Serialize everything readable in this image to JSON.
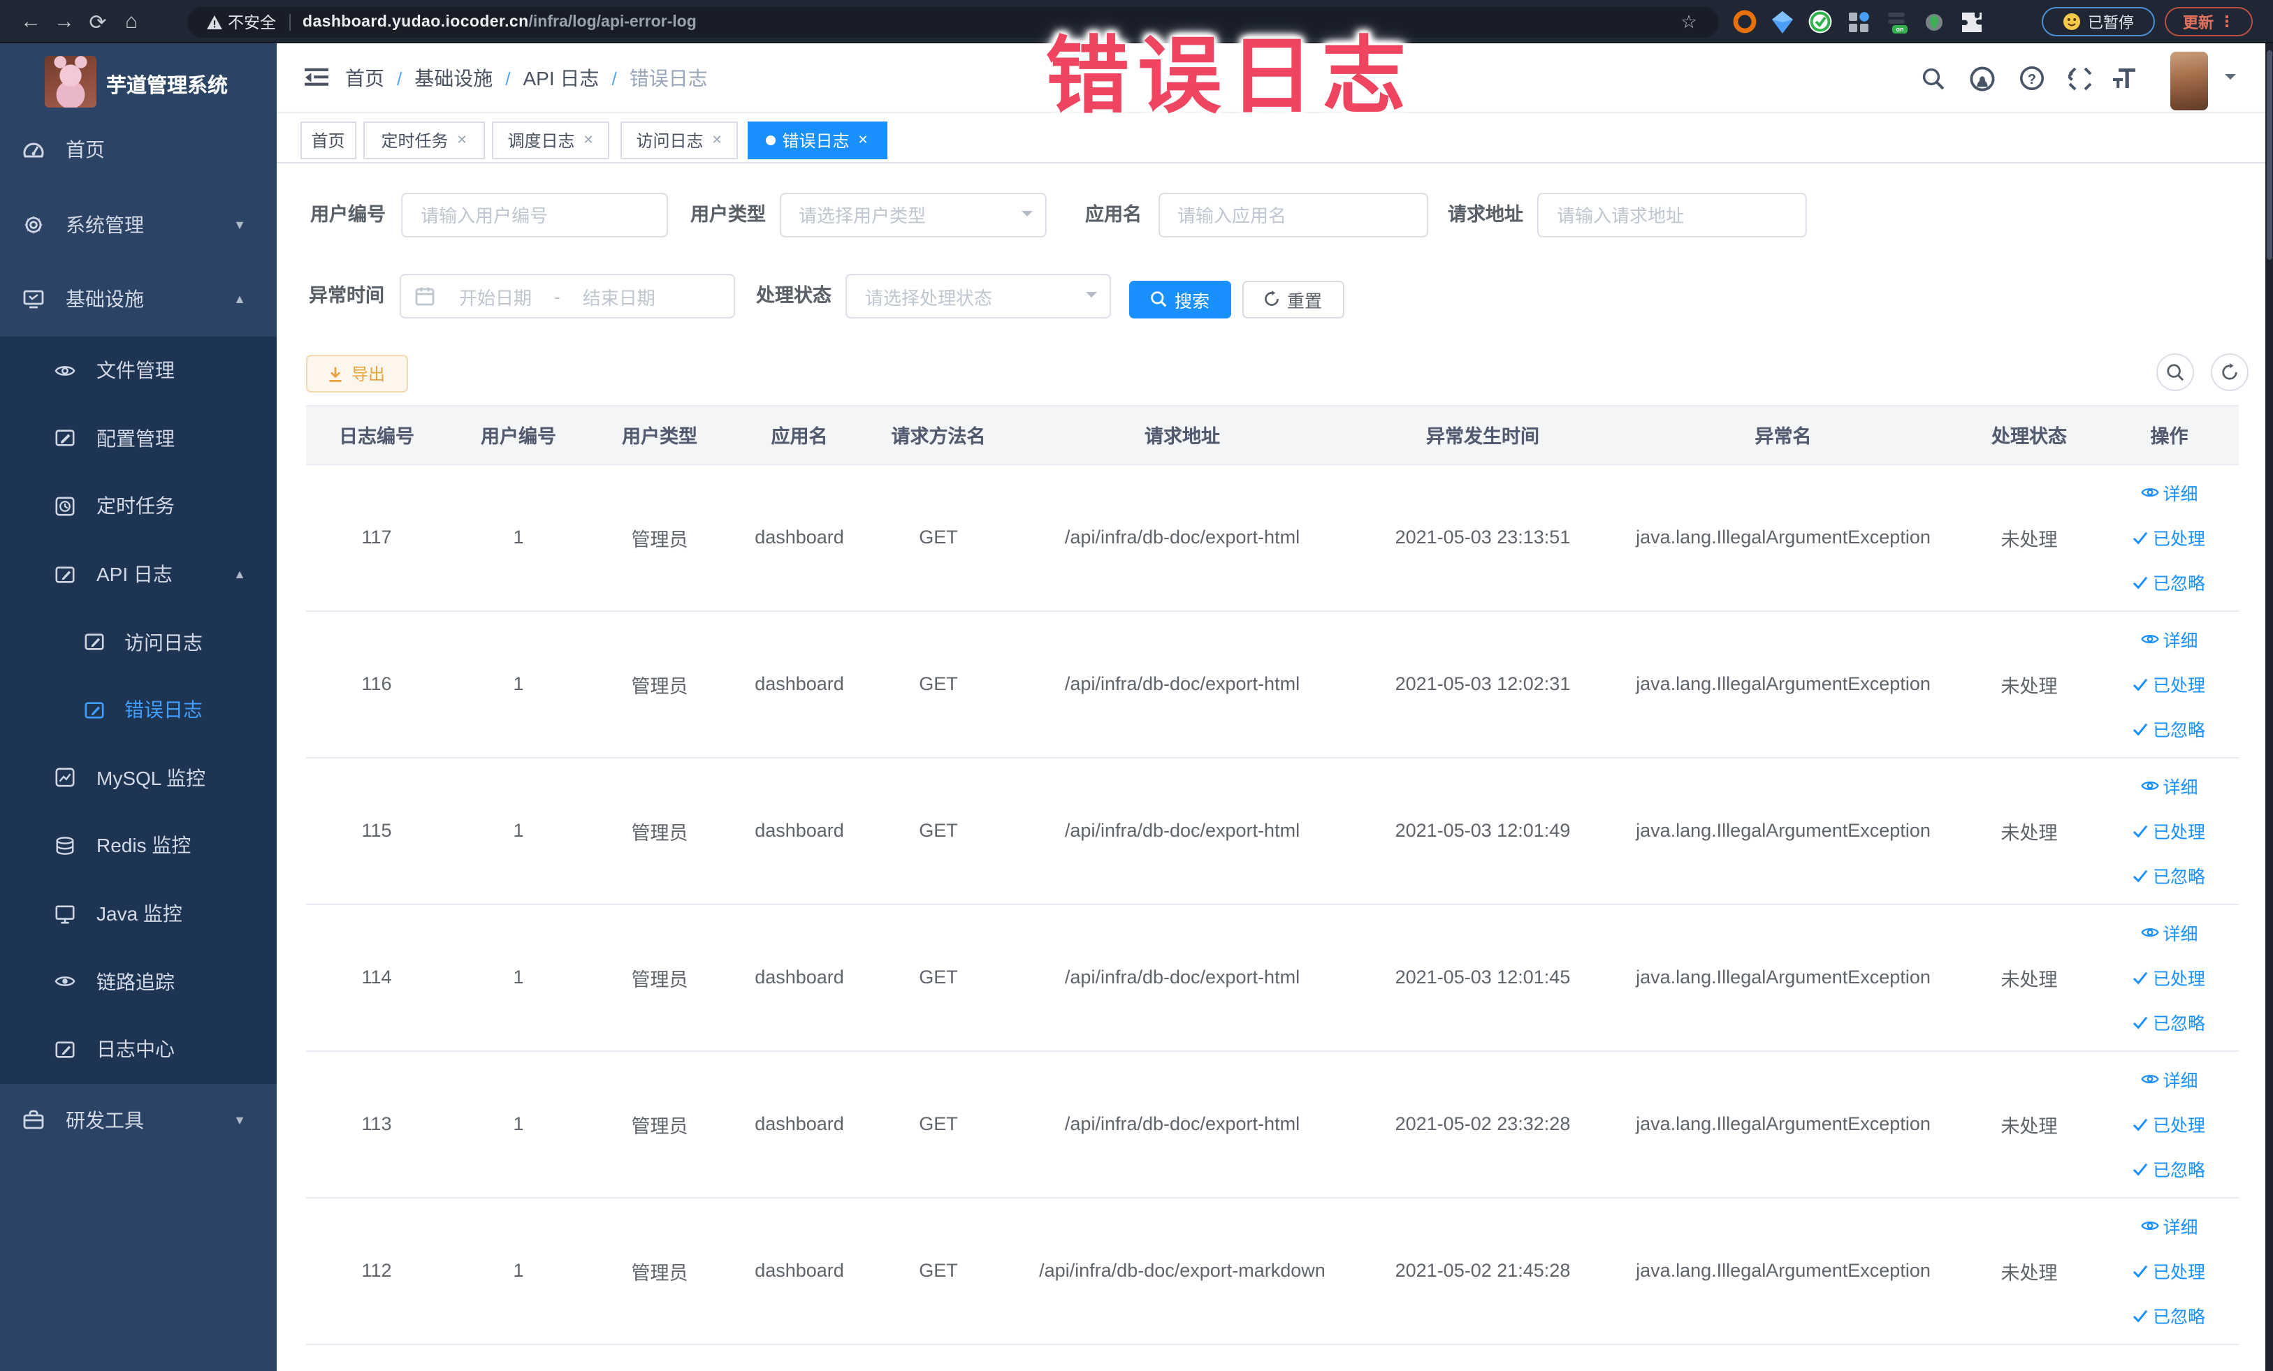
{
  "browser": {
    "security_label": "不安全",
    "url_host": "dashboard.yudao.iocoder.cn",
    "url_path": "/infra/log/api-error-log",
    "paused_label": "已暂停",
    "update_label": "更新"
  },
  "annotation": {
    "text": "错误日志",
    "color": "#ef4560"
  },
  "sidebar": {
    "logo_title": "芋道管理系统",
    "menu": [
      {
        "label": "首页",
        "icon": "dashboard-icon",
        "level": 1,
        "chevron": "",
        "active": false,
        "sub": false
      },
      {
        "label": "系统管理",
        "icon": "gear-icon",
        "level": 1,
        "chevron": "down",
        "active": false,
        "sub": false
      },
      {
        "label": "基础设施",
        "icon": "infra-icon",
        "level": 1,
        "chevron": "up",
        "active": false,
        "sub": false
      },
      {
        "label": "文件管理",
        "icon": "file-icon",
        "level": 2,
        "chevron": "",
        "active": false,
        "sub": true
      },
      {
        "label": "配置管理",
        "icon": "config-icon",
        "level": 2,
        "chevron": "",
        "active": false,
        "sub": true
      },
      {
        "label": "定时任务",
        "icon": "job-icon",
        "level": 2,
        "chevron": "",
        "active": false,
        "sub": true
      },
      {
        "label": "API 日志",
        "icon": "apilog-icon",
        "level": 2,
        "chevron": "up",
        "active": false,
        "sub": true
      },
      {
        "label": "访问日志",
        "icon": "accesslog-icon",
        "level": 3,
        "chevron": "",
        "active": false,
        "sub": true
      },
      {
        "label": "错误日志",
        "icon": "errorlog-icon",
        "level": 3,
        "chevron": "",
        "active": true,
        "sub": true
      },
      {
        "label": "MySQL 监控",
        "icon": "mysql-icon",
        "level": 2,
        "chevron": "",
        "active": false,
        "sub": true
      },
      {
        "label": "Redis 监控",
        "icon": "redis-icon",
        "level": 2,
        "chevron": "",
        "active": false,
        "sub": true
      },
      {
        "label": "Java 监控",
        "icon": "java-icon",
        "level": 2,
        "chevron": "",
        "active": false,
        "sub": true
      },
      {
        "label": "链路追踪",
        "icon": "trace-icon",
        "level": 2,
        "chevron": "",
        "active": false,
        "sub": true
      },
      {
        "label": "日志中心",
        "icon": "logcenter-icon",
        "level": 2,
        "chevron": "",
        "active": false,
        "sub": true
      },
      {
        "label": "研发工具",
        "icon": "tools-icon",
        "level": 1,
        "chevron": "down",
        "active": false,
        "sub": false
      }
    ]
  },
  "header": {
    "breadcrumb": [
      "首页",
      "基础设施",
      "API 日志",
      "错误日志"
    ]
  },
  "tabs": [
    {
      "label": "首页",
      "closable": false,
      "active": false
    },
    {
      "label": "定时任务",
      "closable": true,
      "active": false
    },
    {
      "label": "调度日志",
      "closable": true,
      "active": false
    },
    {
      "label": "访问日志",
      "closable": true,
      "active": false
    },
    {
      "label": "错误日志",
      "closable": true,
      "active": true
    }
  ],
  "filters": {
    "user_id_label": "用户编号",
    "user_id_placeholder": "请输入用户编号",
    "user_type_label": "用户类型",
    "user_type_placeholder": "请选择用户类型",
    "app_name_label": "应用名",
    "app_name_placeholder": "请输入应用名",
    "request_url_label": "请求地址",
    "request_url_placeholder": "请输入请求地址",
    "exception_time_label": "异常时间",
    "date_start_placeholder": "开始日期",
    "date_separator": "-",
    "date_end_placeholder": "结束日期",
    "process_status_label": "处理状态",
    "process_status_placeholder": "请选择处理状态",
    "search_label": "搜索",
    "reset_label": "重置"
  },
  "toolbar": {
    "export_label": "导出"
  },
  "table": {
    "headers": [
      "日志编号",
      "用户编号",
      "用户类型",
      "应用名",
      "请求方法名",
      "请求地址",
      "异常发生时间",
      "异常名",
      "处理状态",
      "操作"
    ],
    "action_labels": [
      "详细",
      "已处理",
      "已忽略"
    ],
    "rows": [
      {
        "id": "117",
        "user_id": "1",
        "user_type": "管理员",
        "app": "dashboard",
        "method": "GET",
        "url": "/api/infra/db-doc/export-html",
        "time": "2021-05-03 23:13:51",
        "exception": "java.lang.IllegalArgumentException",
        "status": "未处理"
      },
      {
        "id": "116",
        "user_id": "1",
        "user_type": "管理员",
        "app": "dashboard",
        "method": "GET",
        "url": "/api/infra/db-doc/export-html",
        "time": "2021-05-03 12:02:31",
        "exception": "java.lang.IllegalArgumentException",
        "status": "未处理"
      },
      {
        "id": "115",
        "user_id": "1",
        "user_type": "管理员",
        "app": "dashboard",
        "method": "GET",
        "url": "/api/infra/db-doc/export-html",
        "time": "2021-05-03 12:01:49",
        "exception": "java.lang.IllegalArgumentException",
        "status": "未处理"
      },
      {
        "id": "114",
        "user_id": "1",
        "user_type": "管理员",
        "app": "dashboard",
        "method": "GET",
        "url": "/api/infra/db-doc/export-html",
        "time": "2021-05-03 12:01:45",
        "exception": "java.lang.IllegalArgumentException",
        "status": "未处理"
      },
      {
        "id": "113",
        "user_id": "1",
        "user_type": "管理员",
        "app": "dashboard",
        "method": "GET",
        "url": "/api/infra/db-doc/export-html",
        "time": "2021-05-02 23:32:28",
        "exception": "java.lang.IllegalArgumentException",
        "status": "未处理"
      },
      {
        "id": "112",
        "user_id": "1",
        "user_type": "管理员",
        "app": "dashboard",
        "method": "GET",
        "url": "/api/infra/db-doc/export-markdown",
        "time": "2021-05-02 21:45:28",
        "exception": "java.lang.IllegalArgumentException",
        "status": "未处理"
      }
    ]
  }
}
